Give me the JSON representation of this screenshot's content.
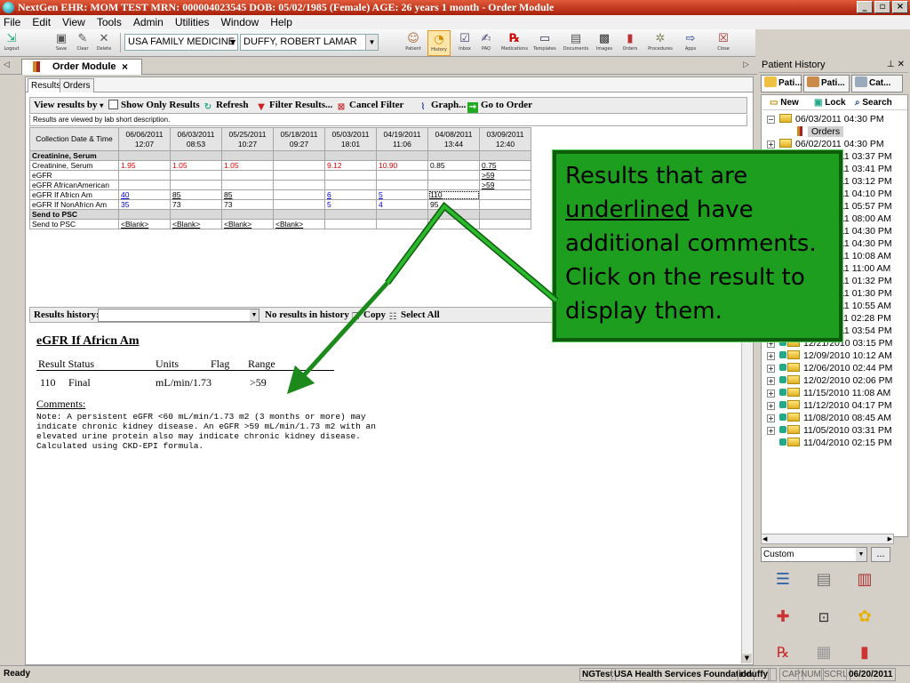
{
  "window": {
    "title": "NextGen EHR: MOM TEST  MRN: 000004023545  DOB: 05/02/1985 (Female)  AGE: 26 years 1 month - Order Module",
    "controls": [
      "_",
      "▫",
      "×"
    ]
  },
  "menu": [
    "File",
    "Edit",
    "View",
    "Tools",
    "Admin",
    "Utilities",
    "Window",
    "Help"
  ],
  "toolbar": {
    "left_buttons": [
      {
        "label": "Logout",
        "icon": "logout-icon"
      },
      {
        "label": "Save",
        "icon": "save-icon"
      },
      {
        "label": "Clear",
        "icon": "clear-icon"
      },
      {
        "label": "Delete",
        "icon": "delete-icon"
      }
    ],
    "practice": "USA FAMILY MEDICINE",
    "provider": "DUFFY, ROBERT  LAMAR",
    "right_buttons": [
      {
        "label": "Patient",
        "icon": "patient-icon"
      },
      {
        "label": "History",
        "icon": "history-icon",
        "active": true
      },
      {
        "label": "Inbox",
        "icon": "inbox-icon"
      },
      {
        "label": "PAQ",
        "icon": "paq-icon"
      },
      {
        "label": "Medications",
        "icon": "rx-icon"
      },
      {
        "label": "Templates",
        "icon": "templates-icon"
      },
      {
        "label": "Documents",
        "icon": "documents-icon"
      },
      {
        "label": "Images",
        "icon": "images-icon"
      },
      {
        "label": "Orders",
        "icon": "orders-icon"
      },
      {
        "label": "Procedures",
        "icon": "procedures-icon"
      },
      {
        "label": "Apps",
        "icon": "apps-icon"
      },
      {
        "label": "Close",
        "icon": "close-icon"
      }
    ]
  },
  "doc_tab": {
    "label": "Order Module",
    "close": "×"
  },
  "sub_tabs": [
    "Results",
    "Orders"
  ],
  "results_toolbar": {
    "view_by": "View results by",
    "show_only": "Show Only Results",
    "refresh": "Refresh",
    "filter": "Filter Results...",
    "cancel_filter": "Cancel Filter",
    "graph": "Graph...",
    "goto": "Go to Order"
  },
  "view_note": "Results are viewed by lab short description.",
  "grid": {
    "header_label": "Collection Date & Time",
    "columns": [
      {
        "date": "06/06/2011",
        "time": "12:07"
      },
      {
        "date": "06/03/2011",
        "time": "08:53"
      },
      {
        "date": "05/25/2011",
        "time": "10:27"
      },
      {
        "date": "05/18/2011",
        "time": "09:27"
      },
      {
        "date": "05/03/2011",
        "time": "18:01"
      },
      {
        "date": "04/19/2011",
        "time": "11:06"
      },
      {
        "date": "04/08/2011",
        "time": "13:44"
      },
      {
        "date": "03/09/2011",
        "time": "12:40"
      }
    ],
    "rows": [
      {
        "label": "Creatinine, Serum",
        "group": true,
        "cells": [
          "",
          "",
          "",
          "",
          "",
          "",
          "",
          ""
        ]
      },
      {
        "label": "Creatinine, Serum",
        "cells": [
          "1.95",
          "1.05",
          "1.05",
          "",
          "9.12",
          "10.90",
          "0.85",
          "0.75"
        ],
        "styles": [
          "red",
          "red",
          "red",
          "",
          "red",
          "red",
          "",
          "u"
        ]
      },
      {
        "label": "eGFR",
        "cells": [
          "",
          "",
          "",
          "",
          "",
          "",
          "",
          ">59"
        ],
        "styles": [
          "",
          "",
          "",
          "",
          "",
          "",
          "",
          "u"
        ]
      },
      {
        "label": "eGFR AfricanAmerican",
        "cells": [
          "",
          "",
          "",
          "",
          "",
          "",
          "",
          ">59"
        ],
        "styles": [
          "",
          "",
          "",
          "",
          "",
          "",
          "",
          "u"
        ]
      },
      {
        "label": "eGFR If Africn Am",
        "cells": [
          "40",
          "85",
          "85",
          "",
          "6",
          "5",
          "110",
          ""
        ],
        "styles": [
          "ul",
          "u",
          "u",
          "",
          "ul",
          "ul",
          "u sel",
          ""
        ]
      },
      {
        "label": "eGFR If NonAfricn Am",
        "cells": [
          "35",
          "73",
          "73",
          "",
          "5",
          "4",
          "95",
          ""
        ],
        "styles": [
          "blue",
          "",
          "",
          "",
          "blue",
          "blue",
          "",
          ""
        ]
      },
      {
        "label": "Send to PSC",
        "group": true,
        "cells": [
          "",
          "",
          "",
          "",
          "",
          "",
          "",
          ""
        ]
      },
      {
        "label": "Send to PSC",
        "cells": [
          "<Blank>",
          "<Blank>",
          "<Blank>",
          "<Blank>",
          "",
          "",
          "",
          ""
        ],
        "styles": [
          "u",
          "u",
          "u",
          "u",
          "",
          "",
          "",
          ""
        ]
      }
    ]
  },
  "history_bar": {
    "label": "Results history:",
    "none": "No results in history",
    "copy": "Copy",
    "select_all": "Select All"
  },
  "detail": {
    "title": "eGFR If Africn Am",
    "headers": [
      "Result Status",
      "Units",
      "Flag",
      "Range"
    ],
    "values": [
      "110",
      "Final",
      "mL/min/1.73",
      "",
      ">59"
    ],
    "comments_label": "Comments:",
    "comment": "Note: A persistent eGFR <60 mL/min/1.73 m2 (3 months or more) may\nindicate chronic kidney disease. An eGFR >59 mL/min/1.73 m2 with an\nelevated urine protein also may indicate chronic kidney disease.\nCalculated using CKD-EPI formula."
  },
  "patient_history": {
    "title": "Patient History",
    "tabs": [
      "Pati...",
      "Pati...",
      "Cat..."
    ],
    "buttons": [
      "New",
      "Lock",
      "Search"
    ],
    "tree": [
      {
        "label": "06/03/2011 04:30 PM",
        "expanded": true,
        "lock": false
      },
      {
        "label": "Orders",
        "child": true
      },
      {
        "label": "06/02/2011 04:30 PM",
        "lock": false
      },
      {
        "label": "06/02/2011 03:37 PM",
        "lock": true
      },
      {
        "label": "05/20/2011 03:41 PM",
        "lock": true
      },
      {
        "label": "05/17/2011 03:12 PM",
        "lock": true
      },
      {
        "label": "05/13/2011 04:10 PM",
        "lock": true
      },
      {
        "label": "05/03/2011 05:57 PM",
        "lock": true
      },
      {
        "label": "04/19/2011 08:00 AM",
        "lock": true
      },
      {
        "label": "04/19/2011 04:30 PM",
        "lock": true
      },
      {
        "label": "04/19/2011 04:30 PM",
        "lock": true
      },
      {
        "label": "04/06/2011 10:08 AM",
        "lock": true
      },
      {
        "label": "03/09/2011 11:00 AM",
        "lock": true
      },
      {
        "label": "03/08/2011 01:32 PM",
        "lock": true
      },
      {
        "label": "03/08/2011 01:30 PM",
        "lock": true
      },
      {
        "label": "01/24/2011 10:55 AM",
        "lock": true
      },
      {
        "label": "01/11/2011 02:28 PM",
        "lock": true
      },
      {
        "label": "01/10/2011 03:54 PM",
        "lock": true
      },
      {
        "label": "12/21/2010 03:15 PM",
        "lock": true
      },
      {
        "label": "12/09/2010 10:12 AM",
        "lock": true
      },
      {
        "label": "12/06/2010 02:44 PM",
        "lock": true
      },
      {
        "label": "12/02/2010 02:06 PM",
        "lock": true
      },
      {
        "label": "11/15/2010 11:08 AM",
        "lock": true
      },
      {
        "label": "11/12/2010 04:17 PM",
        "lock": true
      },
      {
        "label": "11/08/2010 08:45 AM",
        "lock": true
      },
      {
        "label": "11/05/2010 03:31 PM",
        "lock": true
      },
      {
        "label": "11/04/2010 02:15 PM",
        "lock": true,
        "last": true
      }
    ],
    "view_combo": "Custom",
    "dots": "...",
    "icons": [
      "list-icon",
      "notes-icon",
      "chart-icon",
      "medication-icon",
      "rx-doc-icon",
      "allergy-icon",
      "prescription-icon",
      "document-icon",
      "lab-tubes-icon"
    ]
  },
  "status": {
    "ready": "Ready",
    "cells": [
      "NGTest",
      "USA Health Services Foundation",
      "rlduffy",
      "",
      "CAP",
      "NUM",
      "SCRL",
      "06/20/2011"
    ]
  },
  "callout": {
    "lines": [
      "Results that are",
      "underlined have",
      "additional comments.",
      "Click on the result to",
      "display them."
    ],
    "underline_word": "underlined",
    "color": "#1e9e1e"
  }
}
